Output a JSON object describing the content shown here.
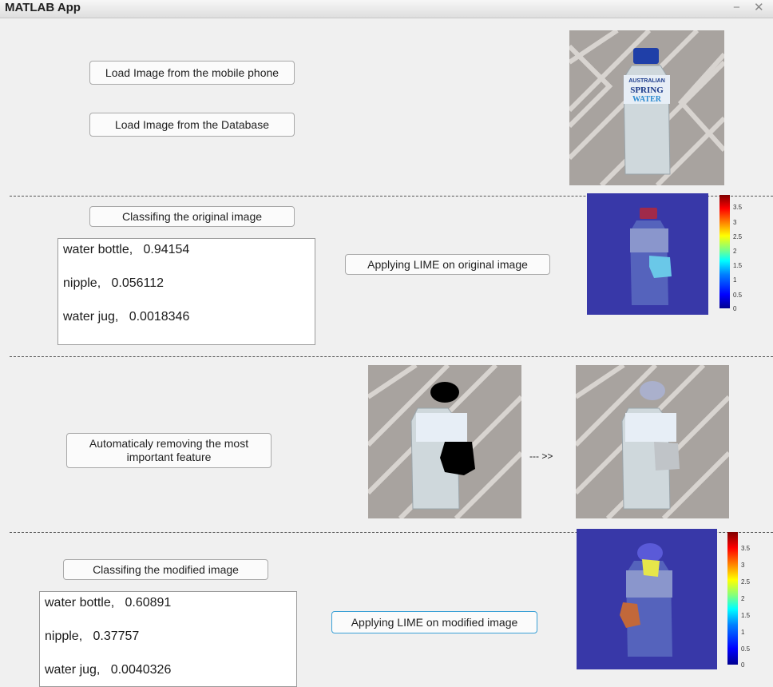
{
  "window": {
    "title": "MATLAB App",
    "minimize_glyph": "−",
    "close_glyph": "✕"
  },
  "buttons": {
    "load_phone": "Load Image from the mobile phone",
    "load_db": "Load Image from the Database",
    "classify_original": "Classifing the original image",
    "lime_original": "Applying LIME on original image",
    "auto_remove_line1": "Automaticaly removing the most",
    "auto_remove_line2": "important feature",
    "classify_modified": "Classifing the modified image",
    "lime_modified": "Applying LIME on modified  image"
  },
  "original_results": [
    {
      "text": "water bottle,   0.94154"
    },
    {
      "text": "nipple,   0.056112"
    },
    {
      "text": "water jug,   0.0018346"
    }
  ],
  "modified_results": [
    {
      "text": "water bottle,   0.60891"
    },
    {
      "text": "nipple,   0.37757"
    },
    {
      "text": "water jug,   0.0040326"
    }
  ],
  "arrow_text": "--- >>",
  "colorbar_ticks_1": [
    "3.5",
    "3",
    "2.5",
    "2",
    "1.5",
    "1",
    "0.5",
    "0"
  ],
  "colorbar_ticks_2": [
    "3.5",
    "3",
    "2.5",
    "2",
    "1.5",
    "1",
    "0.5",
    "0"
  ],
  "bottle_label": {
    "line1": "AUSTRALIAN",
    "line2": "SPRING",
    "line3": "WATER"
  },
  "colors": {
    "accent_border": "#3aa0d6",
    "overlay_blue": "#2a2a9a"
  }
}
